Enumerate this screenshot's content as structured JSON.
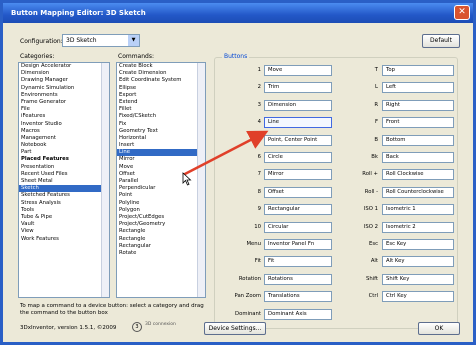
{
  "title": "Button Mapping Editor: 3D Sketch",
  "config": {
    "label": "Configuration:",
    "value": "3D Sketch"
  },
  "default_btn": "Default",
  "categories_label": "Categories:",
  "commands_label": "Commands:",
  "buttons_label": "Buttons",
  "categories": [
    "Design Accelerator",
    "Dimension",
    "Drawing Manager",
    "Dynamic Simulation",
    "Environments",
    "Frame Generator",
    "File",
    "iFeatures",
    "Inventor Studio",
    "Macros",
    "Management",
    "Notebook",
    "Part",
    "Placed Features",
    "Presentation",
    "Recent Used Files",
    "Sheet Metal",
    "Sketch",
    "Sketched Features",
    "Stress Analysis",
    "Tools",
    "Tube & Pipe",
    "Vault",
    "View",
    "Work Features"
  ],
  "selected_category": "Sketch",
  "commands": [
    "Create Block",
    "Create Dimension",
    "Edit Coordinate System",
    "Ellipse",
    "Export",
    "Extend",
    "Fillet",
    "Fixed/CSketch",
    "Fix",
    "Geometry Text",
    "Horizontal",
    "Insert",
    "Line",
    "Mirror",
    "Move",
    "Offset",
    "Parallel",
    "Perpendicular",
    "Point",
    "Polyline",
    "Polygon",
    "Project/CutEdges",
    "Project/Geometry",
    "Rectangle",
    "Rectangle",
    "Rectangular",
    "Rotate"
  ],
  "selected_command": "Line",
  "rows_left": [
    {
      "label": "1",
      "value": "Move"
    },
    {
      "label": "2",
      "value": "Trim"
    },
    {
      "label": "3",
      "value": "Dimension"
    },
    {
      "label": "4",
      "value": "Line"
    },
    {
      "label": "5",
      "value": "Point, Center Point"
    },
    {
      "label": "6",
      "value": "Circle"
    },
    {
      "label": "7",
      "value": "Mirror"
    },
    {
      "label": "8",
      "value": "Offset"
    },
    {
      "label": "9",
      "value": "Rectangular"
    },
    {
      "label": "10",
      "value": "Circular"
    },
    {
      "label": "Menu",
      "value": "Inventor Panel Fn"
    },
    {
      "label": "Fit",
      "value": "Fit"
    },
    {
      "label": "Rotation",
      "value": "Rotations"
    },
    {
      "label": "Pan Zoom",
      "value": "Translations"
    },
    {
      "label": "Dominant",
      "value": "Dominant Axis"
    }
  ],
  "rows_right": [
    {
      "label": "T",
      "value": "Top"
    },
    {
      "label": "L",
      "value": "Left"
    },
    {
      "label": "R",
      "value": "Right"
    },
    {
      "label": "F",
      "value": "Front"
    },
    {
      "label": "B",
      "value": "Bottom"
    },
    {
      "label": "Bk",
      "value": "Back"
    },
    {
      "label": "Roll +",
      "value": "Roll Clockwise"
    },
    {
      "label": "Roll -",
      "value": "Roll Counterclockwise"
    },
    {
      "label": "ISO 1",
      "value": "Isometric 1"
    },
    {
      "label": "ISO 2",
      "value": "Isometric 2"
    },
    {
      "label": "Esc",
      "value": "Esc Key"
    },
    {
      "label": "Alt",
      "value": "Alt Key"
    },
    {
      "label": "Shift",
      "value": "Shift Key"
    },
    {
      "label": "Ctrl",
      "value": "Ctrl Key"
    },
    {
      "label": "",
      "value": ""
    }
  ],
  "instructions": "To map a command to a device button: select a category and drag the command to the button box",
  "version": "3DxInventor, version 1.5.1, ©2009",
  "device_settings_btn": "Device Settings...",
  "ok_btn": "OK",
  "colors": {
    "accent": "#316ac5",
    "arrow": "#e0402a"
  }
}
